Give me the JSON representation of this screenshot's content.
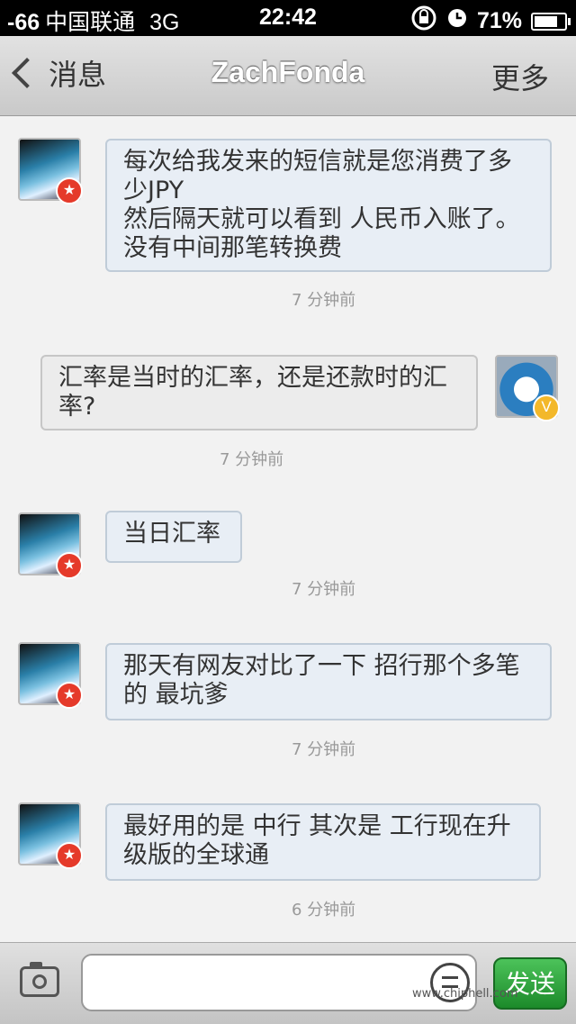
{
  "status_bar": {
    "signal": "-66",
    "carrier": "中国联通",
    "network": "3G",
    "time": "22:42",
    "battery": "71%"
  },
  "nav": {
    "back_label": "消息",
    "title": "ZachFonda",
    "more_label": "更多"
  },
  "messages": [
    {
      "from": "them",
      "lines": [
        "每次给我发来的短信就是您消费了多",
        "少JPY",
        "然后隔天就可以看到 人民币入账了。",
        "没有中间那笔转换费"
      ],
      "time": "7 分钟前"
    },
    {
      "from": "me",
      "lines": [
        "汇率是当时的汇率，还是还款时的汇",
        "率?"
      ],
      "time": "7 分钟前"
    },
    {
      "from": "them",
      "lines": [
        "当日汇率"
      ],
      "time": "7 分钟前"
    },
    {
      "from": "them",
      "lines": [
        "那天有网友对比了一下 招行那个多笔",
        "的 最坑爹"
      ],
      "time": "7 分钟前"
    },
    {
      "from": "them",
      "lines": [
        "最好用的是 中行 其次是 工行现在升",
        "级版的全球通"
      ],
      "time": "6 分钟前"
    }
  ],
  "composer": {
    "input_value": "",
    "send_label": "发送"
  },
  "watermark": "www.chiphell.com",
  "icons": {
    "camera": "camera-icon",
    "emoji": "emoji-icon",
    "back": "chevron-left-icon",
    "badge_them": "star-badge-icon",
    "badge_me": "v-badge-icon"
  }
}
